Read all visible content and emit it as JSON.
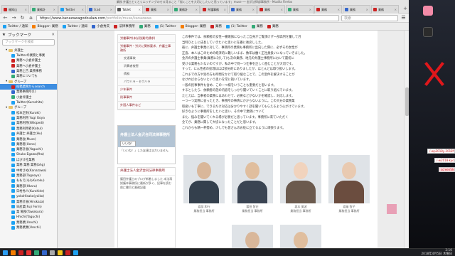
{
  "window_title": "業務 弁護士とくとくエッチングのせる見ること「悩くことを大切にしたいと思っています」muse ── 金沢法律部事務所 - Mozilla Firefox",
  "tabs": [
    {
      "label": "福知山",
      "color": "#c22"
    },
    {
      "label": "業務計",
      "color": "#3a7"
    },
    {
      "label": "Twitter",
      "color": "#1da1f2"
    },
    {
      "label": "tr.ad",
      "color": "#36c"
    },
    {
      "label": "Tablet",
      "color": "#555"
    },
    {
      "label": "業務",
      "color": "#c22"
    },
    {
      "label": "業務計",
      "color": "#3a7"
    },
    {
      "label": "弁護事務",
      "color": "#c22"
    },
    {
      "label": "業務",
      "color": "#36c"
    },
    {
      "label": "業務",
      "color": "#c22"
    },
    {
      "label": "業務",
      "color": "#3a7"
    },
    {
      "label": "業務",
      "color": "#c22"
    },
    {
      "label": "業務",
      "color": "#36c"
    },
    {
      "label": "業務",
      "color": "#c22"
    }
  ],
  "navbar": {
    "back": "←",
    "forward": "→",
    "reload": "↻",
    "home": "⌂",
    "url_host": "https://www.kanazawagodoulaw.com",
    "url_path": "/portfolio/muse/kanazawa",
    "search_placeholder": "検索"
  },
  "bookmarks": [
    {
      "label": "Twitter / 通知",
      "color": "#1da1f2"
    },
    {
      "label": "Blogger: 業務",
      "color": "#f57d00"
    },
    {
      "label": "Twitter / 通知",
      "color": "#1da1f2"
    },
    {
      "label": "小倉秀夫",
      "color": "#36c"
    },
    {
      "label": "法律事務所",
      "color": "#c22"
    },
    {
      "label": "業務",
      "color": "#3a7"
    },
    {
      "label": "(1) Twitter",
      "color": "#1da1f2"
    },
    {
      "label": "Blogger: 業務",
      "color": "#f57d00"
    },
    {
      "label": "業務",
      "color": "#c22"
    },
    {
      "label": "(1) Twitter",
      "color": "#1da1f2"
    },
    {
      "label": "業務",
      "color": "#3a7"
    },
    {
      "label": "業務",
      "color": "#c22"
    }
  ],
  "sidebar": {
    "title": "ブックマーク",
    "close": "✕",
    "search_placeholder": "ブックマークを検索",
    "items": [
      {
        "label": "弁護士",
        "type": "folder",
        "indent": 1
      },
      {
        "label": "Twitterの業務と事業",
        "type": "page",
        "indent": 2,
        "color": "#1da1f2"
      },
      {
        "label": "業務へ小倉弁護士",
        "type": "page",
        "indent": 2,
        "color": "#c22"
      },
      {
        "label": "業務へ小倉弁護士",
        "type": "page",
        "indent": 2,
        "color": "#c22"
      },
      {
        "label": "業務上告 業務事務",
        "type": "page",
        "indent": 2,
        "color": "#36c"
      },
      {
        "label": "業務についても",
        "type": "page",
        "indent": 2,
        "color": "#3a7"
      },
      {
        "label": "グループ",
        "type": "folder",
        "indent": 1
      },
      {
        "label": "投稿業務からsearch",
        "type": "page",
        "indent": 2,
        "color": "#c22",
        "selected": true
      },
      {
        "label": "業務事務所(1)",
        "type": "page",
        "indent": 2,
        "color": "#36c"
      },
      {
        "label": "小倉弁護士",
        "type": "page",
        "indent": 2,
        "color": "#3a7"
      },
      {
        "label": "Twitter(Kuroshita)",
        "type": "page",
        "indent": 2,
        "color": "#1da1f2"
      },
      {
        "label": "グループ",
        "type": "folder",
        "indent": 1
      },
      {
        "label": "松本正則(Kuroki)",
        "type": "page",
        "indent": 2,
        "color": "#1da1f2"
      },
      {
        "label": "業務利用 Yugi Goya",
        "type": "page",
        "indent": 2,
        "color": "#1da1f2"
      },
      {
        "label": "業務利用(Wikipedi)",
        "type": "page",
        "indent": 2,
        "color": "#1da1f2"
      },
      {
        "label": "業務利用者(Kabul)",
        "type": "page",
        "indent": 2,
        "color": "#1da1f2"
      },
      {
        "label": "弁護士 弁護士(Hu)",
        "type": "page",
        "indent": 2,
        "color": "#1da1f2"
      },
      {
        "label": "業務会(Muse)",
        "type": "page",
        "indent": 2,
        "color": "#1da1f2"
      },
      {
        "label": "業務者(Ueno)",
        "type": "page",
        "indent": 2,
        "color": "#1da1f2"
      },
      {
        "label": "業務計画(Yaguchi)",
        "type": "page",
        "indent": 2,
        "color": "#1da1f2"
      },
      {
        "label": "Shuko Egawa(fha)",
        "type": "page",
        "indent": 2,
        "color": "#1da1f2"
      },
      {
        "label": "ばびけ社業務",
        "type": "page",
        "indent": 2,
        "color": "#1da1f2"
      },
      {
        "label": "業務 業務 業務(bhg)",
        "type": "page",
        "indent": 2,
        "color": "#1da1f2"
      },
      {
        "label": "中村さぬ(Kanazawa)",
        "type": "page",
        "indent": 2,
        "color": "#1da1f2"
      },
      {
        "label": "業務部(Tagooyo)",
        "type": "page",
        "indent": 2,
        "color": "#1da1f2"
      },
      {
        "label": "ももえ(ももKuroku)",
        "type": "page",
        "indent": 2,
        "color": "#1da1f2"
      },
      {
        "label": "業務部(Hkaru)",
        "type": "page",
        "indent": 2,
        "color": "#1da1f2"
      },
      {
        "label": "日村秀人(Kurohide)",
        "type": "page",
        "indent": 2,
        "color": "#1da1f2"
      },
      {
        "label": "yokoHisako(yoiko)",
        "type": "page",
        "indent": 2,
        "color": "#1da1f2"
      },
      {
        "label": "業務計画(Hirokaza)",
        "type": "page",
        "indent": 2,
        "color": "#1da1f2"
      },
      {
        "label": "日産業(Fuji Ferm)",
        "type": "page",
        "indent": 2,
        "color": "#1da1f2"
      },
      {
        "label": "業 場部(Tawakura)",
        "type": "page",
        "indent": 2,
        "color": "#1da1f2"
      },
      {
        "label": "Hhichi(Yaguchi)",
        "type": "page",
        "indent": 2,
        "color": "#1da1f2"
      },
      {
        "label": "業務業(Urechi)",
        "type": "page",
        "indent": 2,
        "color": "#1da1f2"
      },
      {
        "label": "業務業業(Urechi)",
        "type": "page",
        "indent": 2,
        "color": "#1da1f2"
      }
    ]
  },
  "page": {
    "menu": [
      {
        "label": "労働事件(未払残業代請求)",
        "sub": false
      },
      {
        "label": "労働事件・労災に関係要求、弁護士事務所",
        "sub": false
      },
      {
        "label": "交通事故",
        "sub": true
      },
      {
        "label": "消費者被害",
        "sub": true
      },
      {
        "label": "債務",
        "sub": true
      },
      {
        "label": "パワハラ・セクハラ",
        "sub": true
      },
      {
        "label": "少年事件",
        "sub": false
      },
      {
        "label": "刑事事件",
        "sub": false
      },
      {
        "label": "外国人事件など",
        "sub": false
      }
    ],
    "fb": {
      "name": "弁護士法人金沢合同法律事務所",
      "like": "いいね！",
      "text": "「いいね！」した友達はまだいません"
    },
    "blog": {
      "title": "弁護士法人金沢合同法律事務所",
      "text": "鍍田弁護士のブログ新着しました 本法再試議本事務所に最新が多く、記事を読む前に書目と業務記載"
    },
    "article": [
      "この事件では、依頼者の女性一審敗訴になったご自身がご覧頂けず一部高判を量して月",
      "当時ひとしに成長していきたいと思いに在番に後戻しした。",
      "彼に、弁護士事業に対して、事務所の業務も事務所に出向した際に、必ずその女性が",
      "正直、本人はこのための経済的に難しいまま、数年は働く正社員扱いになっていきました。",
      "金沢の弁護士事業(業務に対して)も次の業務、地元の弁護士事務所において最初に",
      "受ける業務も少ないのですが、私の中で何一つ仕事を正しく進むことが大切です。",
      "すって、にん性者の処理はほぼ部分的にありましたが、ほとんどは取り扱いします。",
      "これまでの方や別の方も時間をかけて取り組むことで、この案件を解決することが",
      "なければならないという思いを常に抱いています。",
      "一般の民事事件も含め、この一つ様をいうことも重要だと思います。",
      "するとしたら、依頼者の話の内容をしっかり聞いていくことに取り組んでいます。",
      "たとえば、当事者の業務にはあわせて、必要などがないかを確認し、対応します。",
      "一つ一つ実際に会ったとき、事務所の事情にかからないように。この大分の業務業",
      "取扱いも丁寧に、できるだけ対応は分かりやすく話を聞いてもらえるよう心がけています。",
      "好きなように事務所をしたいと思い、その中で業務について",
      "また、悩みを聞いてくれる場が必要だと思っています。事務所に来ていただく",
      "全てが、業務に関して大切になったことだと思います。",
      "これからも精一杯努め、少しでも皆さんのお役に立てるように頑張ります。"
    ],
    "staff": [
      {
        "name": "渡部 和行",
        "sub": "業務担当 事務所"
      },
      {
        "name": "鍍田 智史",
        "sub": "業務担当 事務所"
      },
      {
        "name": "坂本 美波",
        "sub": "業務担当 事務所"
      },
      {
        "name": "渡邉 智子",
        "sub": "業務担当 事務所"
      }
    ]
  },
  "desktop": {
    "icons": [
      {
        "label": "",
        "color": "#f38ba8"
      },
      {
        "label": "",
        "color": "#c22"
      }
    ],
    "snips": [
      "/-wp2018y-2018Y",
      "/-w2018-kyo-akyy-t",
      "screenShot"
    ]
  },
  "taskbar": {
    "time": "2:10",
    "date": "2018年4月5日 木曜日",
    "icons": [
      "#2a9df4",
      "#f57d00",
      "#c22",
      "#e33",
      "#3a7",
      "#36c",
      "#aaa",
      "#f5c518",
      "#c22",
      "#1da1f2"
    ]
  }
}
